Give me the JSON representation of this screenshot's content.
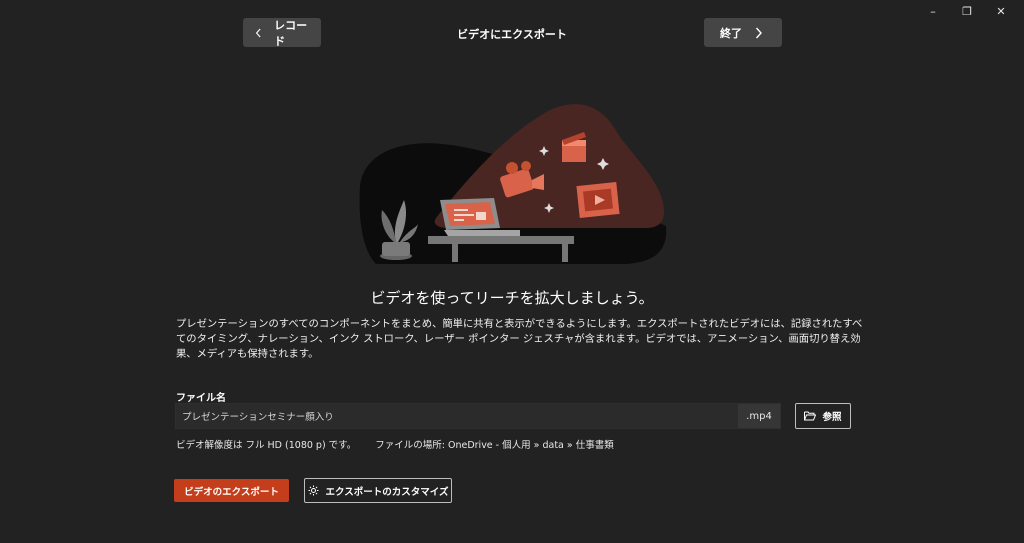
{
  "window_controls": {
    "minimize_glyph": "–",
    "restore_glyph": "❐",
    "close_glyph": "✕"
  },
  "header": {
    "back_label": "レコード",
    "title": "ビデオにエクスポート",
    "finish_label": "終了"
  },
  "main": {
    "headline": "ビデオを使ってリーチを拡大しましょう。",
    "description": "プレゼンテーションのすべてのコンポーネントをまとめ、簡単に共有と表示ができるようにします。エクスポートされたビデオには、記録されたすべてのタイミング、ナレーション、インク ストローク、レーザー ポインター ジェスチャが含まれます。ビデオでは、アニメーション、画面切り替え効果、メディアも保持されます。"
  },
  "file": {
    "label": "ファイル名",
    "value": "プレゼンテーションセミナー顔入り",
    "extension": ".mp4",
    "browse_label": "参照",
    "resolution_text": "ビデオ解像度は フル HD (1080 p) です。",
    "location_text": "ファイルの場所: OneDrive - 個人用 » data » 仕事書類"
  },
  "actions": {
    "export_label": "ビデオのエクスポート",
    "customize_label": "エクスポートのカスタマイズ"
  },
  "colors": {
    "background": "#222222",
    "accent": "#c43e1c",
    "nav_button": "#454545"
  }
}
